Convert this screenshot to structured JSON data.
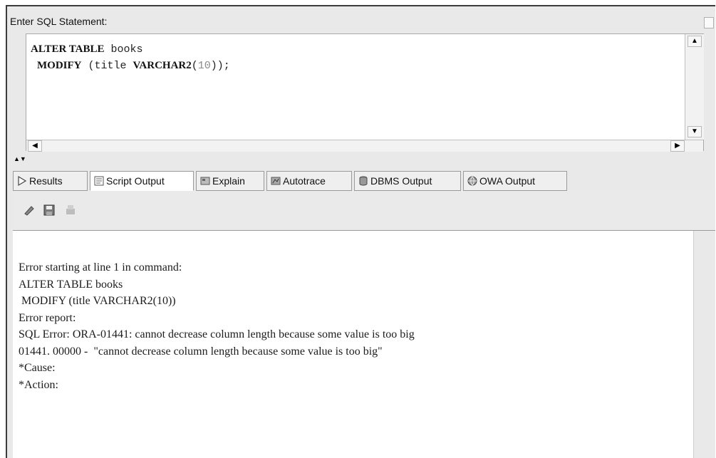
{
  "sql_panel": {
    "label": "Enter SQL Statement:",
    "line1_kw1": "ALTER TABLE",
    "line1_rest": " books",
    "line2_kw1": "MODIFY",
    "line2_mid": " (title ",
    "line2_kw2": "VARCHAR2",
    "line2_open": "(",
    "line2_num": "10",
    "line2_close": "));"
  },
  "tabs": [
    {
      "label": "Results",
      "icon": "play-icon"
    },
    {
      "label": "Script Output",
      "icon": "script-icon"
    },
    {
      "label": "Explain",
      "icon": "explain-icon"
    },
    {
      "label": "Autotrace",
      "icon": "autotrace-icon"
    },
    {
      "label": "DBMS Output",
      "icon": "dbms-icon"
    },
    {
      "label": "OWA Output",
      "icon": "owa-icon"
    }
  ],
  "active_tab": "Script Output",
  "toolbar": {
    "icons": [
      "eraser-icon",
      "save-icon",
      "print-icon"
    ]
  },
  "output": {
    "lines": [
      "Error starting at line 1 in command:",
      "ALTER TABLE books",
      " MODIFY (title VARCHAR2(10))",
      "Error report:",
      "SQL Error: ORA-01441: cannot decrease column length because some value is too big",
      "01441. 00000 -  \"cannot decrease column length because some value is too big\"",
      "*Cause:",
      "*Action:"
    ]
  }
}
